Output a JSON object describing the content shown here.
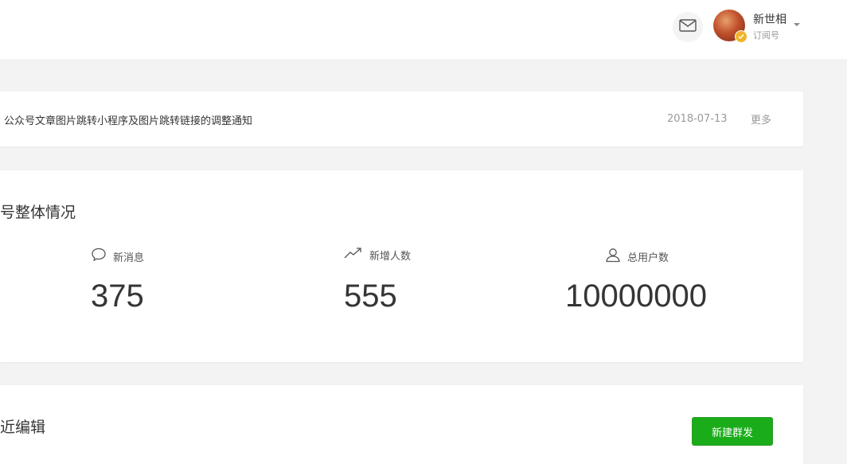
{
  "header": {
    "account_name": "新世相",
    "account_type": "订阅号"
  },
  "notice": {
    "title": "公众号文章图片跳转小程序及图片跳转链接的调整通知",
    "date": "2018-07-13",
    "more_label": "更多"
  },
  "overview": {
    "title": "号整体情况",
    "stats": [
      {
        "label": "新消息",
        "value": "375",
        "icon": "message-bubble-icon"
      },
      {
        "label": "新增人数",
        "value": "555",
        "icon": "trend-up-icon"
      },
      {
        "label": "总用户数",
        "value": "10000000",
        "icon": "user-icon"
      }
    ]
  },
  "recent": {
    "title": "近编辑",
    "new_send_label": "新建群发"
  },
  "colors": {
    "primary_green": "#1aad19",
    "page_bg": "#f3f3f3",
    "text_primary": "#353535",
    "text_secondary": "#9a9a9a",
    "verified_badge": "#f0b429"
  }
}
